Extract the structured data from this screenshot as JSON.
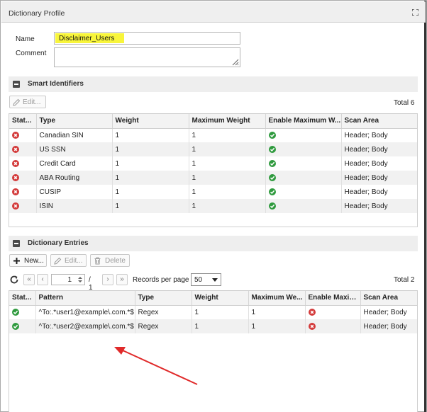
{
  "window": {
    "title": "Dictionary Profile",
    "maximize_icon": "maximize-icon"
  },
  "form": {
    "name_label": "Name",
    "name_value": "Disclaimer_Users",
    "comment_label": "Comment",
    "comment_value": ""
  },
  "smart_identifiers": {
    "title": "Smart Identifiers",
    "edit_label": "Edit...",
    "total": "Total 6",
    "columns": [
      "Stat...",
      "Type",
      "Weight",
      "Maximum Weight",
      "Enable Maximum W...",
      "Scan Area"
    ],
    "rows": [
      {
        "status": "disabled",
        "type": "Canadian SIN",
        "weight": "1",
        "max_weight": "1",
        "enable_max": "enabled",
        "scan_area": "Header; Body"
      },
      {
        "status": "disabled",
        "type": "US SSN",
        "weight": "1",
        "max_weight": "1",
        "enable_max": "enabled",
        "scan_area": "Header; Body"
      },
      {
        "status": "disabled",
        "type": "Credit Card",
        "weight": "1",
        "max_weight": "1",
        "enable_max": "enabled",
        "scan_area": "Header; Body"
      },
      {
        "status": "disabled",
        "type": "ABA Routing",
        "weight": "1",
        "max_weight": "1",
        "enable_max": "enabled",
        "scan_area": "Header; Body"
      },
      {
        "status": "disabled",
        "type": "CUSIP",
        "weight": "1",
        "max_weight": "1",
        "enable_max": "enabled",
        "scan_area": "Header; Body"
      },
      {
        "status": "disabled",
        "type": "ISIN",
        "weight": "1",
        "max_weight": "1",
        "enable_max": "enabled",
        "scan_area": "Header; Body"
      }
    ]
  },
  "dictionary_entries": {
    "title": "Dictionary Entries",
    "new_label": "New...",
    "edit_label": "Edit...",
    "delete_label": "Delete",
    "page_value": "1",
    "page_of": "/ 1",
    "records_per_page_label": "Records per page",
    "records_per_page_value": "50",
    "total": "Total 2",
    "columns": [
      "Stat...",
      "Pattern",
      "Type",
      "Weight",
      "Maximum We...",
      "Enable Maxim...",
      "Scan Area"
    ],
    "rows": [
      {
        "status": "enabled",
        "pattern": "^To:.*user1@example\\.com.*$",
        "type": "Regex",
        "weight": "1",
        "max_weight": "1",
        "enable_max": "disabled",
        "scan_area": "Header; Body"
      },
      {
        "status": "enabled",
        "pattern": "^To:.*user2@example\\.com.*$",
        "type": "Regex",
        "weight": "1",
        "max_weight": "1",
        "enable_max": "disabled",
        "scan_area": "Header; Body"
      }
    ]
  },
  "colors": {
    "annotation_arrow": "#e02a2a",
    "highlight": "#f8f53b",
    "ok": "#2f9a3e",
    "bad": "#d33a3a"
  }
}
